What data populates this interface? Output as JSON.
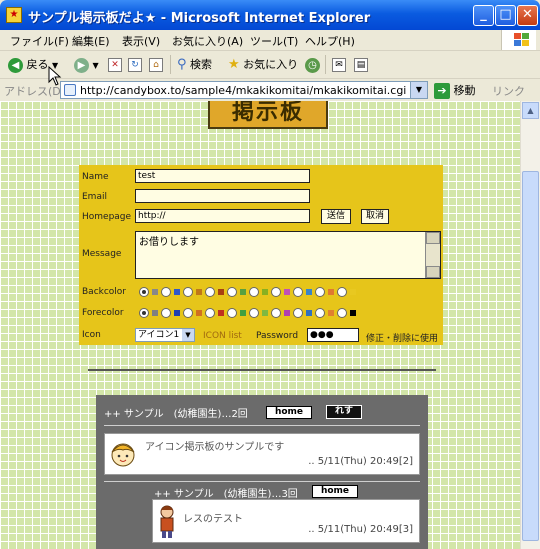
{
  "window": {
    "title": "サンプル掲示板だよ★ - Microsoft Internet Explorer",
    "min_symbol": "_",
    "max_symbol": "□",
    "close_symbol": "✕"
  },
  "menu": {
    "items": [
      "ファイル(F)",
      "編集(E)",
      "表示(V)",
      "お気に入り(A)",
      "ツール(T)",
      "ヘルプ(H)"
    ]
  },
  "toolbar": {
    "back_label": "戻る",
    "search_label": "検索",
    "favorites_label": "お気に入り"
  },
  "address": {
    "label": "アドレス(D)",
    "url": "http://candybox.to/sample4/mkakikomitai/mkakikomitai.cgi",
    "go_label": "移動",
    "links_label": "リンク"
  },
  "page": {
    "logo_text": "掲示板",
    "form": {
      "name_label": "Name",
      "name_value": "test",
      "email_label": "Email",
      "email_value": "",
      "homepage_label": "Homepage",
      "homepage_value": "http://",
      "submit_label": "送信",
      "cancel_label": "取消",
      "message_label": "Message",
      "message_value": "お借りします",
      "backcolor_label": "Backcolor",
      "forecolor_label": "Forecolor",
      "icon_label": "Icon",
      "icon_value": "アイコン1",
      "icon_list_label": "ICON list",
      "password_label": "Password",
      "password_value": "●●●",
      "password_note": "修正・削除に使用",
      "back_colors": [
        "#888888",
        "#2f58c8",
        "#c07818",
        "#a84010",
        "#58a040",
        "#88b020",
        "#c050b8",
        "#3a84c8",
        "#e07830",
        "#e8c820"
      ],
      "fore_colors": [
        "#808080",
        "#2040b0",
        "#d07020",
        "#c03020",
        "#40a040",
        "#80b840",
        "#b040b0",
        "#3070c0",
        "#e08030",
        "#000000"
      ],
      "back_selected": 0,
      "fore_selected": 0
    },
    "thread": {
      "header": "++ サンプル　(幼稚園生)…2回",
      "home_label": "home",
      "reply_label": "れす",
      "post1_text": "アイコン掲示板のサンプルです",
      "post1_date": ".. 5/11(Thu) 20:49[2]",
      "reply_header": "++ サンプル　(幼稚園生)…3回",
      "post2_text": "レスのテスト",
      "post2_date": ".. 5/11(Thu) 20:49[3]"
    }
  },
  "colors": {
    "form_bg": "#e6c51a",
    "grid_bg": "#d3e6a9",
    "thread_bg": "#6b6b6b"
  }
}
